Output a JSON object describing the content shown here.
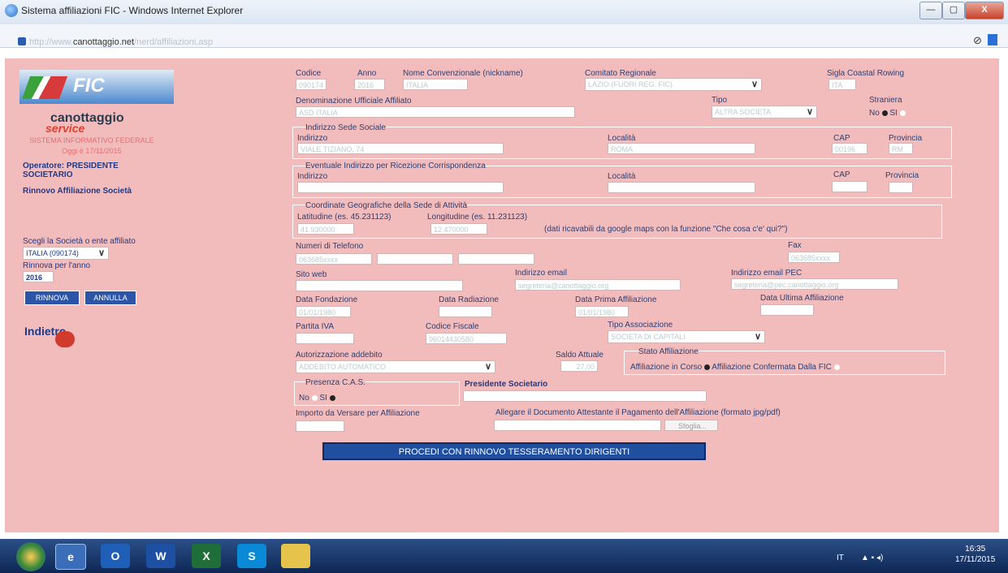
{
  "window": {
    "title": "Sistema affiliazioni FIC - Windows Internet Explorer",
    "minimize": "—",
    "maximize": "▢",
    "close": "X"
  },
  "address": {
    "prefix": "http://",
    "www": "www.",
    "domain": "canottaggio.net",
    "path": "/nerd/affiliazioni.asp"
  },
  "sidebar": {
    "logo": "FIC",
    "brand": "canottaggio",
    "service": "service",
    "system": "SISTEMA INFORMATIVO FEDERALE",
    "date": "Oggi è 17/11/2015",
    "operator": "Operatore: PRESIDENTE SOCIETARIO",
    "section": "Rinnovo Affiliazione Società",
    "choose_label": "Scegli la Società o ente affiliato",
    "society_value": "ITALIA (090174)",
    "renew_year_label": "Rinnova per l'anno",
    "renew_year": "2016",
    "btn_renew": "RINNOVA",
    "btn_cancel": "ANNULLA",
    "back": "Indietro"
  },
  "form": {
    "codice": "Codice",
    "codice_val": "090174",
    "anno": "Anno",
    "anno_val": "2016",
    "nome_conv": "Nome Convenzionale (nickname)",
    "nome_conv_val": "ITALIA",
    "comitato": "Comitato Regionale",
    "comitato_val": "LAZIO (FUORI REG. FIC)",
    "sigla": "Sigla Coastal Rowing",
    "sigla_val": "ITA",
    "denominazione": "Denominazione Ufficiale Affiliato",
    "denominazione_val": "ASD ITALIA",
    "tipo": "Tipo",
    "tipo_val": "ALTRA SOCIETA",
    "straniera": "Straniera",
    "no": "No",
    "si": "SI",
    "sede": "Indirizzo Sede Sociale",
    "indirizzo": "Indirizzo",
    "indirizzo_val": "VIALE TIZIANO, 74",
    "localita": "Località",
    "localita_val": "ROMA",
    "cap": "CAP",
    "cap_val": "00196",
    "provincia": "Provincia",
    "provincia_val": "RM",
    "corrisp": "Eventuale Indirizzo per Ricezione Corrispondenza",
    "coord": "Coordinate Geografiche della Sede di Attività",
    "lat": "Latitudine (es. 45.231123)",
    "lat_val": "41.930000",
    "lon": "Longitudine (es. 11.231123)",
    "lon_val": "12.470000",
    "coord_note": "(dati ricavabili da google maps con la funzione \"Che cosa c'e' qui?\")",
    "telefono": "Numeri di Telefono",
    "tel_val": "063685xxxx",
    "fax": "Fax",
    "fax_val": "063685xxxx",
    "sito": "Sito web",
    "email": "Indirizzo email",
    "email_val": "segreteria@canottaggio.org",
    "pec": "Indirizzo email PEC",
    "pec_val": "segreteria@pec.canottaggio.org",
    "fondazione": "Data Fondazione",
    "fondazione_val": "01/01/1980",
    "radiazione": "Data Radiazione",
    "prima": "Data Prima Affiliazione",
    "prima_val": "01/01/1980",
    "ultima": "Data Ultima Affiliazione",
    "piva": "Partita IVA",
    "cf": "Codice Fiscale",
    "cf_val": "96014430580",
    "tipo_assoc": "Tipo Associazione",
    "tipo_assoc_val": "SOCIETA DI CAPITALI",
    "autorizzazione": "Autorizzazione addebito",
    "autorizzazione_val": "ADDEBITO AUTOMATICO",
    "saldo": "Saldo Attuale",
    "saldo_val": "27,00",
    "stato": "Stato Affiliazione",
    "in_corso": "Affiliazione in Corso",
    "confermata": "Affiliazione Confermata Dalla FIC",
    "cas": "Presenza C.A.S.",
    "presidente": "Presidente Societario",
    "importo": "Importo da Versare per Affiliazione",
    "allegare": "Allegare il Documento Attestante il Pagamento dell'Affiliazione (formato jpg/pdf)",
    "sfoglia": "Sfoglia...",
    "procedi": "PROCEDI CON RINNOVO TESSERAMENTO DIRIGENTI"
  },
  "taskbar": {
    "tray": "IT",
    "time": "16:35",
    "date": "17/11/2015",
    "apps": [
      "O",
      "W",
      "X",
      "S"
    ]
  }
}
